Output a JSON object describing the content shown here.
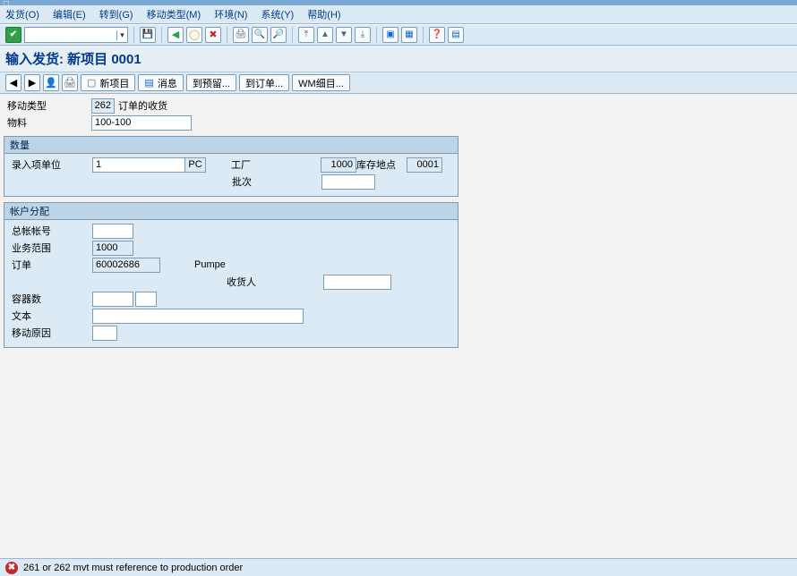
{
  "menu": {
    "items": [
      "发货(O)",
      "编辑(E)",
      "转到(G)",
      "移动类型(M)",
      "环境(N)",
      "系统(Y)",
      "帮助(H)"
    ]
  },
  "screen_title": "输入发货: 新项目 0001",
  "app_toolbar": {
    "new_item": "新项目",
    "messages": "消息",
    "to_reservation": "到预留...",
    "to_order": "到订单...",
    "wm_detail": "WM细目..."
  },
  "header": {
    "mvmt_type_label": "移动类型",
    "mvmt_type": "262",
    "mvmt_type_desc": "订单的收货",
    "material_label": "物料",
    "material": "100-100"
  },
  "qty_group": {
    "title": "数量",
    "entry_unit_label": "录入项单位",
    "entry_qty": "1",
    "entry_unit": "PC",
    "plant_label": "工厂",
    "plant": "1000",
    "stg_loc_label": "库存地点",
    "stg_loc": "0001",
    "batch_label": "批次",
    "batch": ""
  },
  "acct_group": {
    "title": "帐户分配",
    "gl_label": "总帐帐号",
    "gl": "",
    "business_area_label": "业务范围",
    "business_area": "1000",
    "order_label": "订单",
    "order": "60002686",
    "order_desc": "Pumpe",
    "recipient_label": "收货人",
    "recipient": "",
    "containers_label": "容器数",
    "containers_a": "",
    "containers_b": "",
    "text_label": "文本",
    "text": "",
    "reason_label": "移动原因",
    "reason": ""
  },
  "status": {
    "msg": "261 or 262 mvt must reference to production order"
  }
}
